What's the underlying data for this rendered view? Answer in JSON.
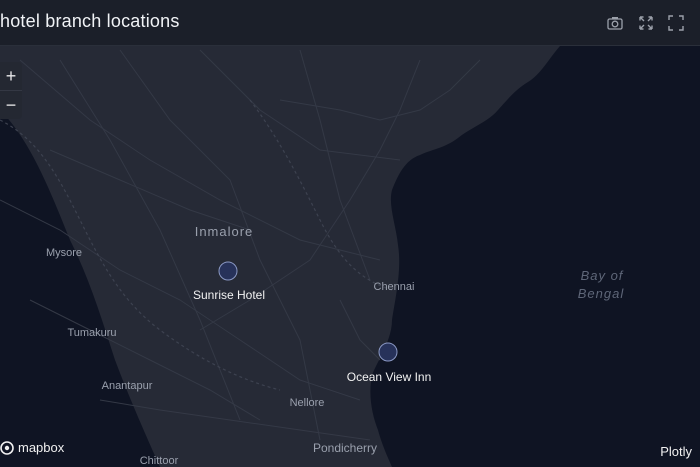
{
  "title": "hotel branch locations",
  "toolbar": {
    "camera_icon": "camera-icon",
    "autoscale_icon": "autoscale-icon",
    "fullscreen_icon": "fullscreen-icon"
  },
  "zoom": {
    "in_label": "+",
    "out_label": "−"
  },
  "colors": {
    "land": "#262a36",
    "sea": "#0f1423",
    "roads": "#343946",
    "marker_fill": "#27325a",
    "marker_stroke": "#8a98c4",
    "label": "#f2f2f2",
    "place": "#9aa0ad"
  },
  "markers": [
    {
      "label": "Sunrise Hotel"
    },
    {
      "label": "Ocean View Inn"
    }
  ],
  "places": [
    {
      "name": "Inmalore"
    },
    {
      "name": "Mysore"
    },
    {
      "name": "Chennai"
    },
    {
      "name": "Tumakuru"
    },
    {
      "name": "Anantapur"
    },
    {
      "name": "Nellore"
    },
    {
      "name": "Pondicherry"
    },
    {
      "name": "Chittoor"
    }
  ],
  "sea_label": {
    "line1": "Bay of",
    "line2": "Bengal"
  },
  "attribution": {
    "mapbox": "mapbox",
    "plotly": "Plotly"
  }
}
